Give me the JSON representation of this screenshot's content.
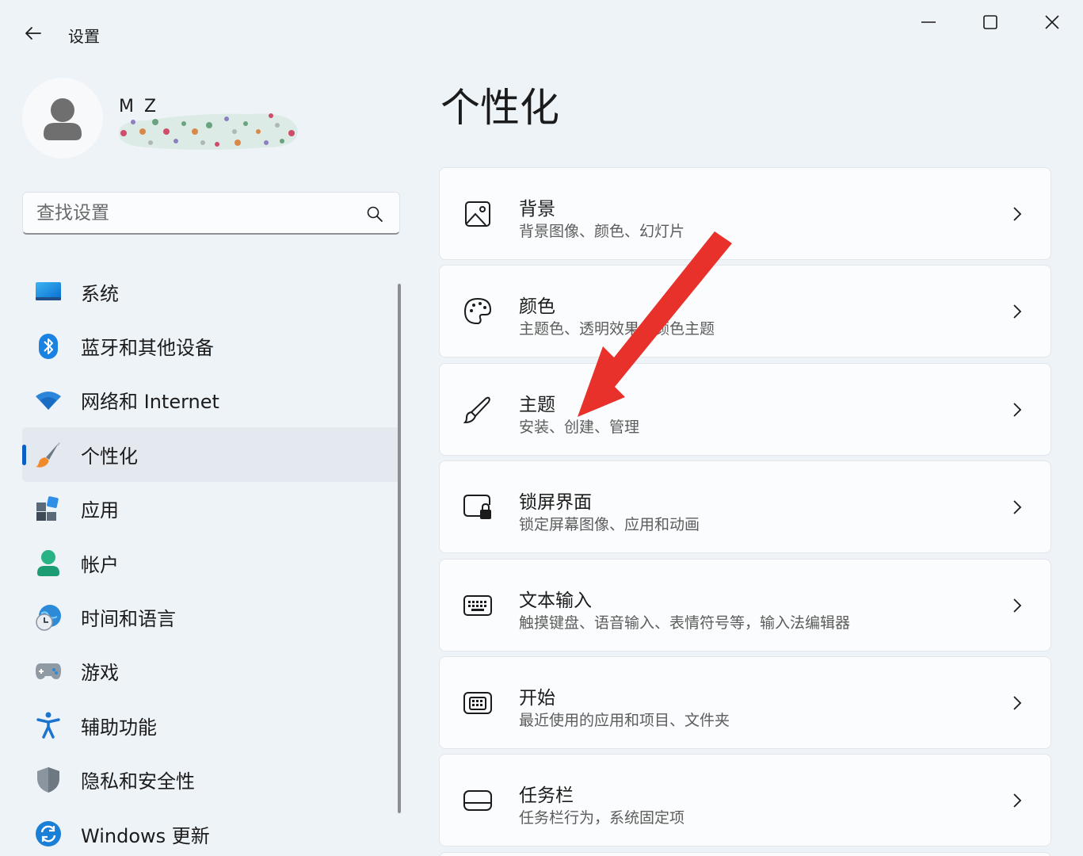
{
  "app": {
    "title": "设置",
    "back_icon": "back-arrow-icon"
  },
  "window_controls": {
    "minimize_icon": "minimize-icon",
    "maximize_icon": "maximize-icon",
    "close_icon": "close-icon"
  },
  "profile": {
    "name": "M Z",
    "avatar_icon": "user-avatar-icon"
  },
  "search": {
    "placeholder": "查找设置",
    "icon": "search-icon"
  },
  "sidebar": {
    "items": [
      {
        "label": "系统",
        "icon": "system-display-icon"
      },
      {
        "label": "蓝牙和其他设备",
        "icon": "bluetooth-icon"
      },
      {
        "label": "网络和 Internet",
        "icon": "wifi-icon"
      },
      {
        "label": "个性化",
        "icon": "paintbrush-icon",
        "active": true
      },
      {
        "label": "应用",
        "icon": "apps-icon"
      },
      {
        "label": "帐户",
        "icon": "account-icon"
      },
      {
        "label": "时间和语言",
        "icon": "time-language-icon"
      },
      {
        "label": "游戏",
        "icon": "gamepad-icon"
      },
      {
        "label": "辅助功能",
        "icon": "accessibility-icon"
      },
      {
        "label": "隐私和安全性",
        "icon": "shield-icon"
      },
      {
        "label": "Windows 更新",
        "icon": "windows-update-icon"
      }
    ]
  },
  "main": {
    "title": "个性化",
    "cards": [
      {
        "title": "背景",
        "subtitle": "背景图像、颜色、幻灯片",
        "icon": "image-icon"
      },
      {
        "title": "颜色",
        "subtitle": "主题色、透明效果、颜色主题",
        "icon": "palette-icon"
      },
      {
        "title": "主题",
        "subtitle": "安装、创建、管理",
        "icon": "brush-icon"
      },
      {
        "title": "锁屏界面",
        "subtitle": "锁定屏幕图像、应用和动画",
        "icon": "lock-screen-icon"
      },
      {
        "title": "文本输入",
        "subtitle": "触摸键盘、语音输入、表情符号等，输入法编辑器",
        "icon": "keyboard-icon"
      },
      {
        "title": "开始",
        "subtitle": "最近使用的应用和项目、文件夹",
        "icon": "start-menu-icon"
      },
      {
        "title": "任务栏",
        "subtitle": "任务栏行为，系统固定项",
        "icon": "taskbar-icon"
      }
    ],
    "chevron_icon": "chevron-right-icon"
  },
  "annotation": {
    "arrow_color": "#e8312b",
    "accent_color": "#0a5fc4"
  }
}
